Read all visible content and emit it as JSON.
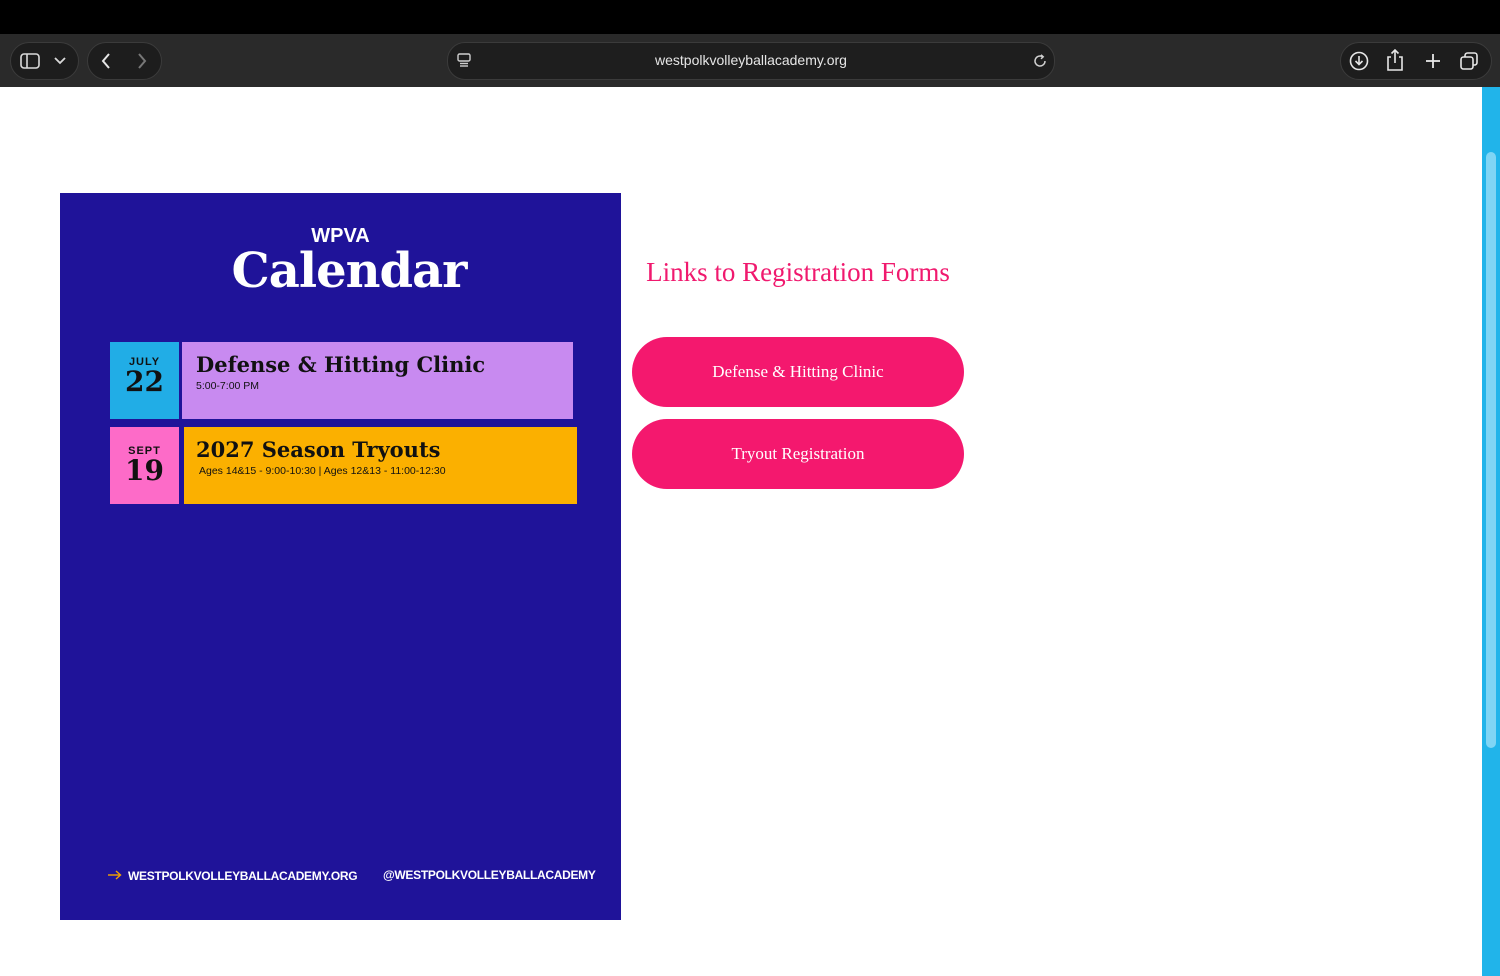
{
  "browser": {
    "url": "westpolkvolleyballacademy.org"
  },
  "poster": {
    "org": "WPVA",
    "title": "Calendar",
    "events": [
      {
        "month": "JULY",
        "day": "22",
        "title": "Defense & Hitting Clinic",
        "detail": "5:00-7:00 PM"
      },
      {
        "month": "SEPT",
        "day": "19",
        "title": "2027 Season Tryouts",
        "detail": "Ages 14&15 - 9:00-10:30 | Ages 12&13 - 11:00-12:30"
      }
    ],
    "footer_site": "WESTPOLKVOLLEYBALLACADEMY.ORG",
    "footer_handle": "@WESTPOLKVOLLEYBALLACADEMY",
    "colors": {
      "background": "#1f1399",
      "date1": "#21ade6",
      "event1": "#c88af0",
      "date2": "#fd6bc8",
      "event2": "#fbb000",
      "arrow": "#f4a300"
    }
  },
  "registration": {
    "heading": "Links to Registration Forms",
    "buttons": [
      "Defense & Hitting Clinic",
      "Tryout Registration"
    ],
    "accent": "#f4186e"
  }
}
